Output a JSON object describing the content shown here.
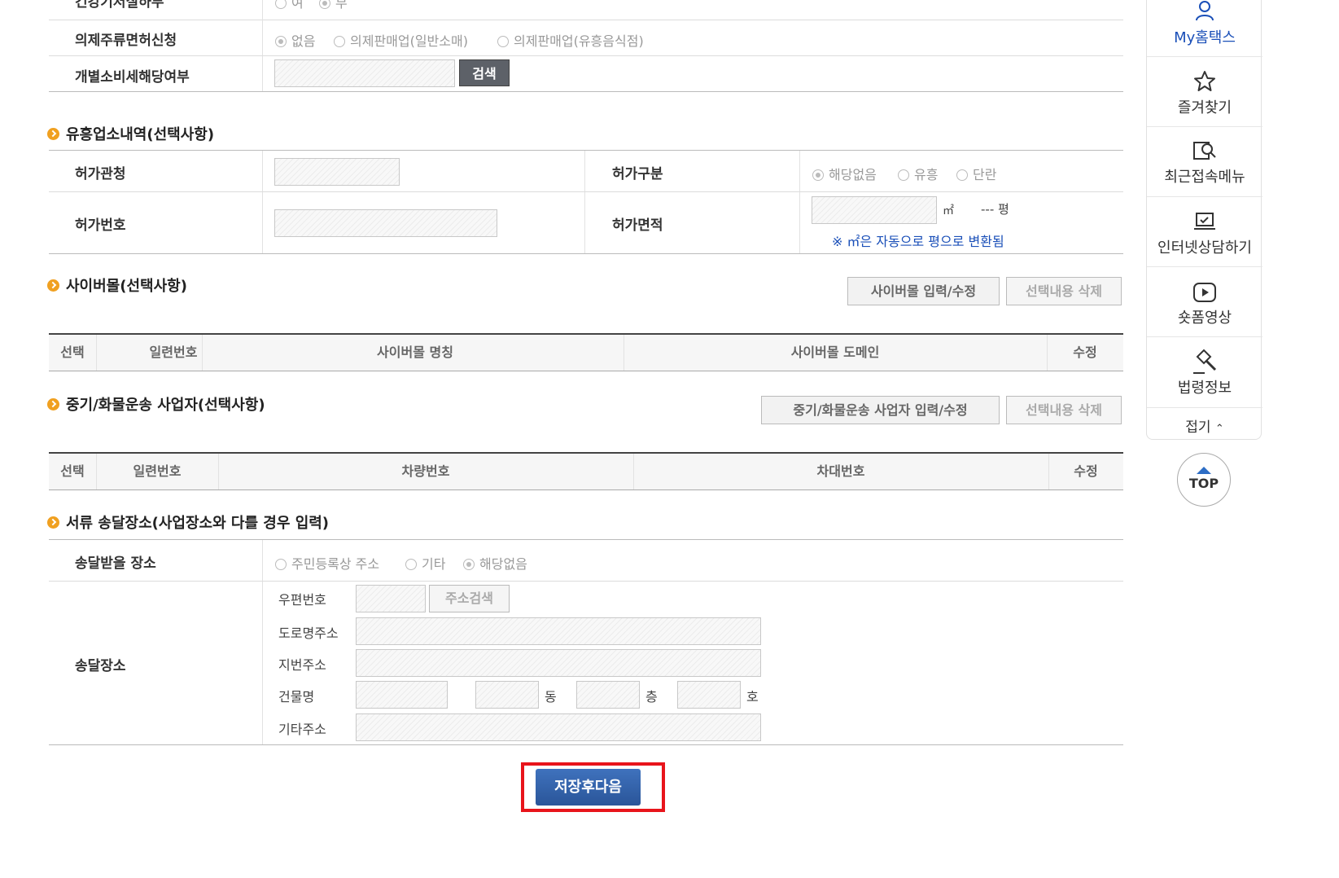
{
  "form": {
    "row_top_partial_label": "건강기저질하부",
    "row_top_partial_opts": [
      "여",
      "부"
    ],
    "liquor_label": "의제주류면허신청",
    "liquor_options": [
      "없음",
      "의제판매업(일반소매)",
      "의제판매업(유흥음식점)"
    ],
    "excise_label": "개별소비세해당여부",
    "search_btn": "검색"
  },
  "entertainment": {
    "title": "유흥업소내역(선택사항)",
    "authority_label": "허가관청",
    "type_label": "허가구분",
    "type_options": [
      "해당없음",
      "유흥",
      "단란"
    ],
    "number_label": "허가번호",
    "area_label": "허가면적",
    "area_unit": "㎡",
    "area_pyeong": "--- 평",
    "area_note": "※ ㎡은 자동으로 평으로 변환됨"
  },
  "cybermall": {
    "title": "사이버몰(선택사항)",
    "btn_input": "사이버몰 입력/수정",
    "btn_delete": "선택내용 삭제",
    "columns": [
      "선택",
      "일련번호",
      "사이버몰 명칭",
      "사이버몰 도메인",
      "수정"
    ]
  },
  "freight": {
    "title": "중기/화물운송 사업자(선택사항)",
    "btn_input": "중기/화물운송 사업자 입력/수정",
    "btn_delete": "선택내용 삭제",
    "columns": [
      "선택",
      "일련번호",
      "차량번호",
      "차대번호",
      "수정"
    ]
  },
  "delivery": {
    "title": "서류 송달장소(사업장소와 다를 경우 입력)",
    "place_label": "송달받을 장소",
    "place_options": [
      "주민등록상 주소",
      "기타",
      "해당없음"
    ],
    "address_label": "송달장소",
    "postal_label": "우편번호",
    "postal_btn": "주소검색",
    "road_label": "도로명주소",
    "lot_label": "지번주소",
    "building_label": "건물명",
    "dong": "동",
    "floor": "층",
    "ho": "호",
    "other_label": "기타주소"
  },
  "submit_label": "저장후다음",
  "sidebar": {
    "items": [
      "My홈택스",
      "즐겨찾기",
      "최근접속메뉴",
      "인터넷상담하기",
      "숏폼영상",
      "법령정보"
    ],
    "collapse": "접기",
    "top": "TOP"
  },
  "colors": {
    "accent": "#2d5fa8",
    "highlight": "#e8141b",
    "bullet": "#f0a020",
    "link": "#1a4fb8"
  }
}
